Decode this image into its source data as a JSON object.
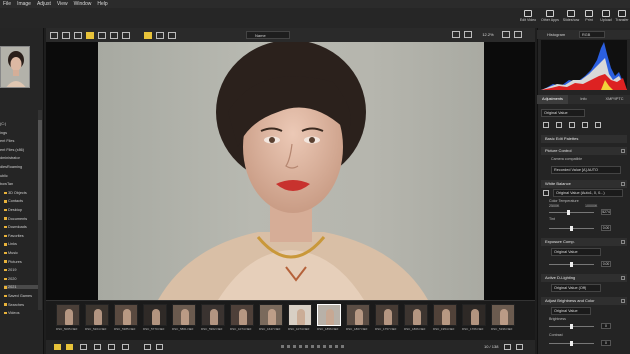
{
  "menu": [
    "File",
    "Image",
    "Adjust",
    "View",
    "Window",
    "Help"
  ],
  "toolbar": {
    "buttons": [
      "Edit Video",
      "Other Apps",
      "Slideshow",
      "Print",
      "Upload",
      "Transfer"
    ]
  },
  "left_panel": {
    "tree": [
      "(C:)",
      "ings",
      "ent Files",
      "ent Files (x86)",
      "dministrator",
      "dlesRoaming",
      "ublic",
      "bowTan",
      "3D Objects",
      "Contacts",
      "Desktop",
      "Documents",
      "Downloads",
      "Favorites",
      "Links",
      "Music",
      "Pictures",
      "2019",
      "2020",
      "2021",
      "Saved Games",
      "Searches",
      "Videos"
    ],
    "selected_index": 19
  },
  "viewer_toolbar": {
    "sort_label": "Name",
    "zoom": "12.2%"
  },
  "filmstrip": {
    "captions": [
      "DSC_5065.NEF",
      "DSC_5204.NEF",
      "DSC_5385.NEF",
      "DSC_5770.NEF",
      "DSC_5861.NEF",
      "DSC_5962.NEF",
      "DSC_1074.NEF",
      "DSC_1647.NEF",
      "DSC_1074.NEF",
      "DSC_1856.NEF",
      "DSC_1867.NEF",
      "DSC_1757.NEF",
      "DSC_1866.NEF",
      "DSC_1954.NEF",
      "DSC_1766.NEF",
      "DSC_5196.NEF"
    ],
    "selected_index": 9
  },
  "bottom": {
    "page_count": "10 / 138"
  },
  "right_panel": {
    "histogram_title": "Histogram",
    "histogram_channel": "RGB",
    "tabs": [
      "Adjustments",
      "Info",
      "XMP/IPTC"
    ],
    "active_tab": 0,
    "preset": "Original Value",
    "sections": {
      "basic": "Basic Edit Palettes",
      "picture_control": "Picture Control",
      "picture_control_hint": "Camera compatible",
      "picture_control_value": "Recorded Value [A] AUTO",
      "white_balance": "White Balance",
      "white_balance_value": "Original Value (Auto1, 0, 0...)",
      "color_temp_label": "Color Temperature",
      "color_temp_min": "2500K",
      "color_temp_max": "10000K",
      "color_temp_value": "5274",
      "tint_label": "Tint",
      "tint_value": "0.00",
      "exposure": "Exposure Comp.",
      "exposure_value": "Original Value",
      "exposure_num": "0.00",
      "adl": "Active D-Lighting",
      "adl_value": "Original Value (Off)",
      "brightness_color": "Adjust Brightness and Color",
      "bc_value": "Original Value",
      "brightness_label": "Brightness",
      "brightness_num": "0",
      "contrast_label": "Contrast",
      "contrast_num": "0"
    }
  },
  "colors": {
    "accent": "#e8c33a",
    "folder": "#e8b23a"
  }
}
